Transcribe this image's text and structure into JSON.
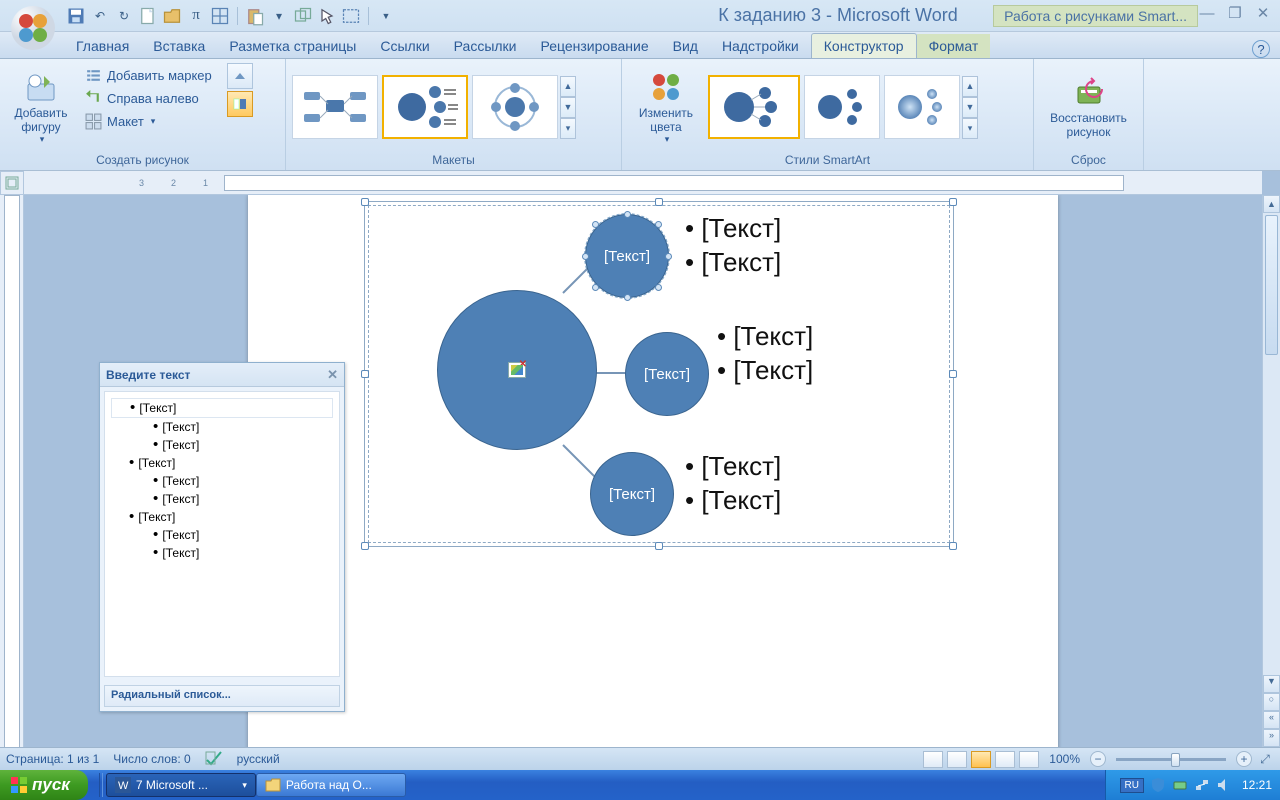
{
  "title": {
    "doc": "К заданию 3",
    "app": "Microsoft Word",
    "tool_tab": "Работа с рисунками Smart..."
  },
  "qat_items": [
    "save",
    "undo",
    "redo",
    "new",
    "open",
    "pi",
    "table",
    "paste",
    "special",
    "arrow",
    "select",
    "para-marks",
    "more"
  ],
  "tabs": [
    "Главная",
    "Вставка",
    "Разметка страницы",
    "Ссылки",
    "Рассылки",
    "Рецензирование",
    "Вид",
    "Надстройки"
  ],
  "context_tabs": [
    "Конструктор",
    "Формат"
  ],
  "ribbon": {
    "g1": {
      "label": "Создать рисунок",
      "add_shape": "Добавить\nфигуру",
      "add_bullet": "Добавить маркер",
      "rtl": "Справа налево",
      "layout": "Макет"
    },
    "g2": {
      "label": "Макеты"
    },
    "g3": {
      "label": "Стили SmartArt",
      "change_colors": "Изменить\nцвета"
    },
    "g4": {
      "label": "Сброс",
      "reset": "Восстановить\nрисунок"
    }
  },
  "textpane": {
    "title": "Введите текст",
    "footer": "Радиальный список...",
    "items": [
      {
        "level": 1,
        "text": "[Текст]",
        "sel": true
      },
      {
        "level": 2,
        "text": "[Текст]"
      },
      {
        "level": 2,
        "text": "[Текст]"
      },
      {
        "level": 1,
        "text": "[Текст]"
      },
      {
        "level": 2,
        "text": "[Текст]"
      },
      {
        "level": 2,
        "text": "[Текст]"
      },
      {
        "level": 1,
        "text": "[Текст]"
      },
      {
        "level": 2,
        "text": "[Текст]"
      },
      {
        "level": 2,
        "text": "[Текст]"
      }
    ]
  },
  "diagram": {
    "node_label": "[Текст]",
    "bullets": [
      [
        "[Текст]",
        "[Текст]"
      ],
      [
        "[Текст]",
        "[Текст]"
      ],
      [
        "[Текст]",
        "[Текст]"
      ]
    ]
  },
  "status": {
    "page": "Страница: 1 из 1",
    "words": "Число слов: 0",
    "lang": "русский",
    "zoom": "100%"
  },
  "taskbar": {
    "start": "пуск",
    "items": [
      "7 Microsoft ...",
      "Работа над О..."
    ],
    "lang": "RU",
    "clock": "12:21"
  }
}
